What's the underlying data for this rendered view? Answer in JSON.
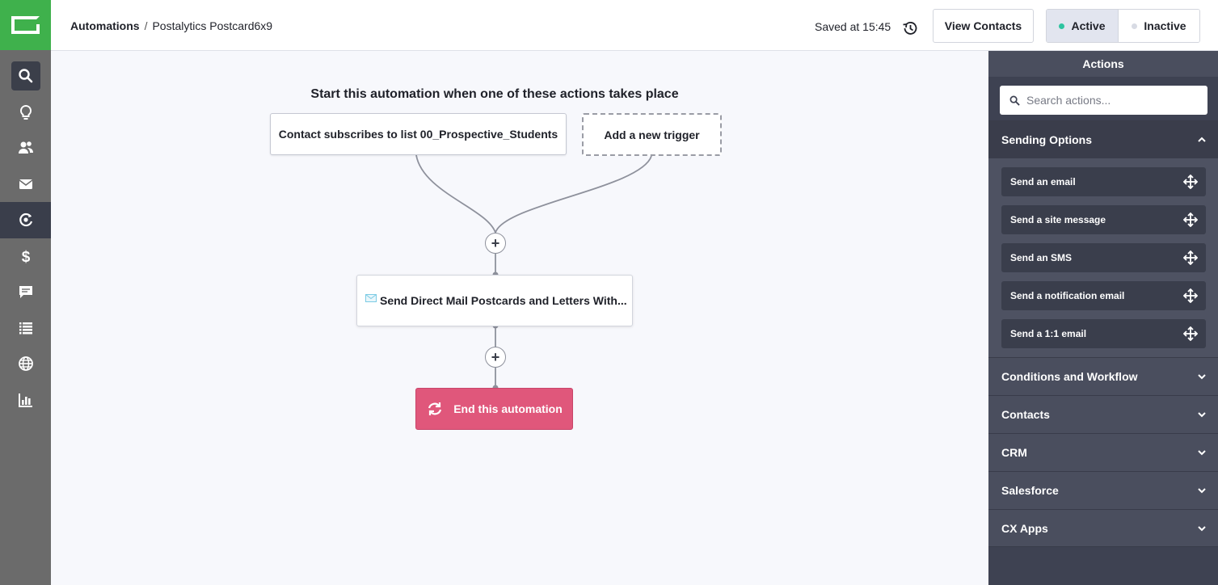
{
  "nav": {
    "items": [
      {
        "name": "search-nav",
        "icon": "search-icon"
      },
      {
        "name": "lightbulb-nav",
        "icon": "lightbulb-icon"
      },
      {
        "name": "contacts-nav",
        "icon": "contacts-icon"
      },
      {
        "name": "campaigns-nav",
        "icon": "mail-icon"
      },
      {
        "name": "automations-nav",
        "icon": "automation-icon"
      },
      {
        "name": "deals-nav",
        "icon": "dollar-icon"
      },
      {
        "name": "conversations-nav",
        "icon": "chat-icon"
      },
      {
        "name": "lists-nav",
        "icon": "list-icon"
      },
      {
        "name": "website-nav",
        "icon": "globe-icon"
      },
      {
        "name": "reports-nav",
        "icon": "chart-icon"
      }
    ]
  },
  "header": {
    "breadcrumb_root": "Automations",
    "breadcrumb_sep": "/",
    "breadcrumb_current": "Postalytics Postcard6x9",
    "saved": "Saved at 15:45",
    "view_contacts": "View Contacts",
    "active_label": "Active",
    "inactive_label": "Inactive",
    "active_color": "#2ec4a0",
    "inactive_color": "#d8dbe4"
  },
  "canvas": {
    "start_title": "Start this automation when one of these actions takes place",
    "trigger": "Contact subscribes to list 00_Prospective_Students",
    "add_trigger": "Add a new trigger",
    "action": "Send Direct Mail Postcards and Letters With...",
    "end": "End this automation",
    "plus": "+"
  },
  "panel": {
    "title": "Actions",
    "search_placeholder": "Search actions...",
    "sections": {
      "sending": "Sending Options",
      "conditions": "Conditions and Workflow",
      "contacts": "Contacts",
      "crm": "CRM",
      "salesforce": "Salesforce",
      "cx": "CX Apps"
    },
    "sending_items": [
      "Send an email",
      "Send a site message",
      "Send an SMS",
      "Send a notification email",
      "Send a 1:1 email"
    ]
  }
}
